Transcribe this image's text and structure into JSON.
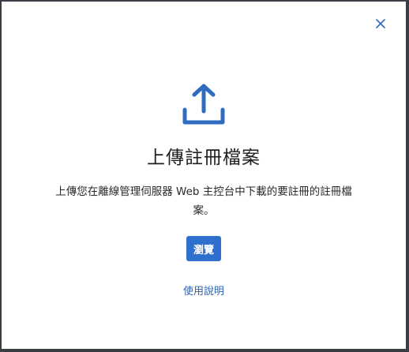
{
  "dialog": {
    "title": "上傳註冊檔案",
    "description": "上傳您在離線管理伺服器 Web 主控台中下載的要註冊的註冊檔案。",
    "browse_label": "瀏覽",
    "help_label": "使用說明"
  },
  "icons": {
    "close": "close-icon",
    "upload": "upload-icon"
  },
  "colors": {
    "accent": "#2f6fce",
    "link": "#2d62b0",
    "icon": "#2f6bbf",
    "background": "#3b3f45",
    "dialog_bg": "#ffffff"
  }
}
